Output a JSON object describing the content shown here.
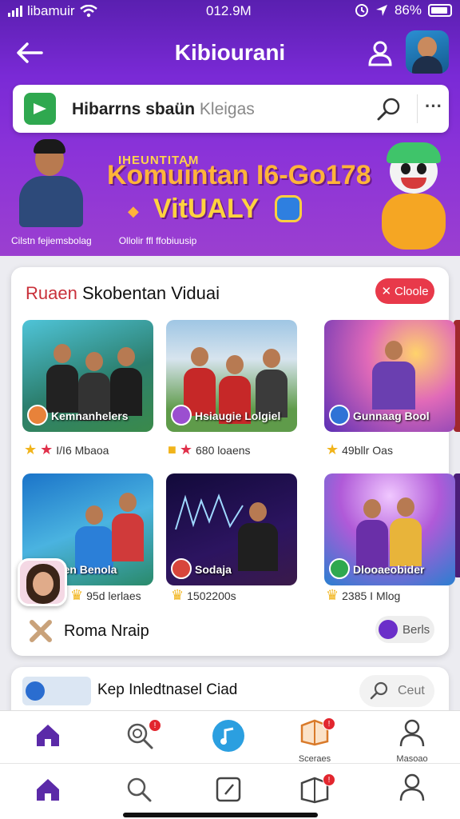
{
  "status_bar": {
    "carrier": "libamuir",
    "time": "012.9M",
    "battery": "86%"
  },
  "header": {
    "title": "Kibiourani",
    "search_query_bold": "Hibarrns sbaün",
    "search_query_light": "Kleigas"
  },
  "banner": {
    "overline": "IHEUNTITAM",
    "title": "Komuintan I6-Go178",
    "subtitle": "VitUALY",
    "footer_left": "Cilstn fejiemsbolag",
    "footer_right": "Ollolir ffl ffobiuusip"
  },
  "section": {
    "title_accent": "Ruaen",
    "title_rest": " Skobentan Viduai",
    "close_label": "Cloole",
    "tiles": [
      {
        "caption": "Kemnanhelers",
        "meta": "I/I6 Mbaoa"
      },
      {
        "caption": "Hsiaugie Lolgiel",
        "meta": "680 loaens"
      },
      {
        "caption": "Gunnaag Bool",
        "meta": "49bllr Oas"
      },
      {
        "caption": "Ilsen Benola",
        "meta": "95d lerlaes"
      },
      {
        "caption": "Sodaja",
        "meta": "1502200s"
      },
      {
        "caption": "Dlooaeobider",
        "meta": "2385 I Mlog"
      }
    ],
    "footer_label": "Roma Nraip",
    "footer_pill": "Berls"
  },
  "next_card": {
    "title": "Kep Inledtnasel Ciad",
    "search_pill": "Ceut"
  },
  "nav_top": {
    "items": [
      {
        "label": ""
      },
      {
        "label": ""
      },
      {
        "label": ""
      },
      {
        "label": "Sceraes"
      },
      {
        "label": "Masoao"
      }
    ]
  },
  "colors": {
    "header_purple": "#7a2ad6",
    "accent_red": "#e8394a",
    "nav_purple": "#5b2aa8"
  }
}
